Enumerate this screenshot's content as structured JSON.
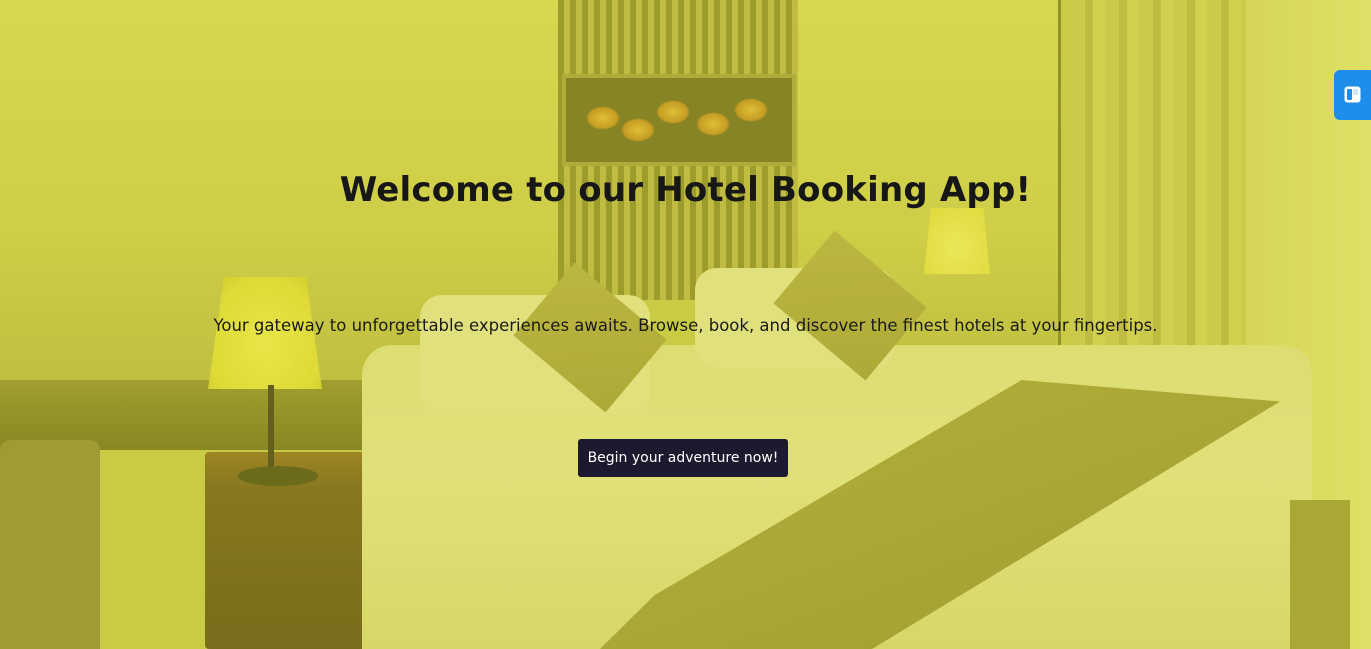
{
  "hero": {
    "title": "Welcome to our Hotel Booking App!",
    "subtitle": "Your gateway to unforgettable experiences awaits. Browse, book, and discover the finest hotels at your fingertips.",
    "cta_label": "Begin your adventure now!"
  },
  "side_widget": {
    "icon": "panel-icon",
    "color": "#1e8eea"
  },
  "colors": {
    "overlay_tint": "#c7c94f",
    "button_bg": "#1b1a2e",
    "button_text": "#ffffff",
    "text": "#171717"
  }
}
